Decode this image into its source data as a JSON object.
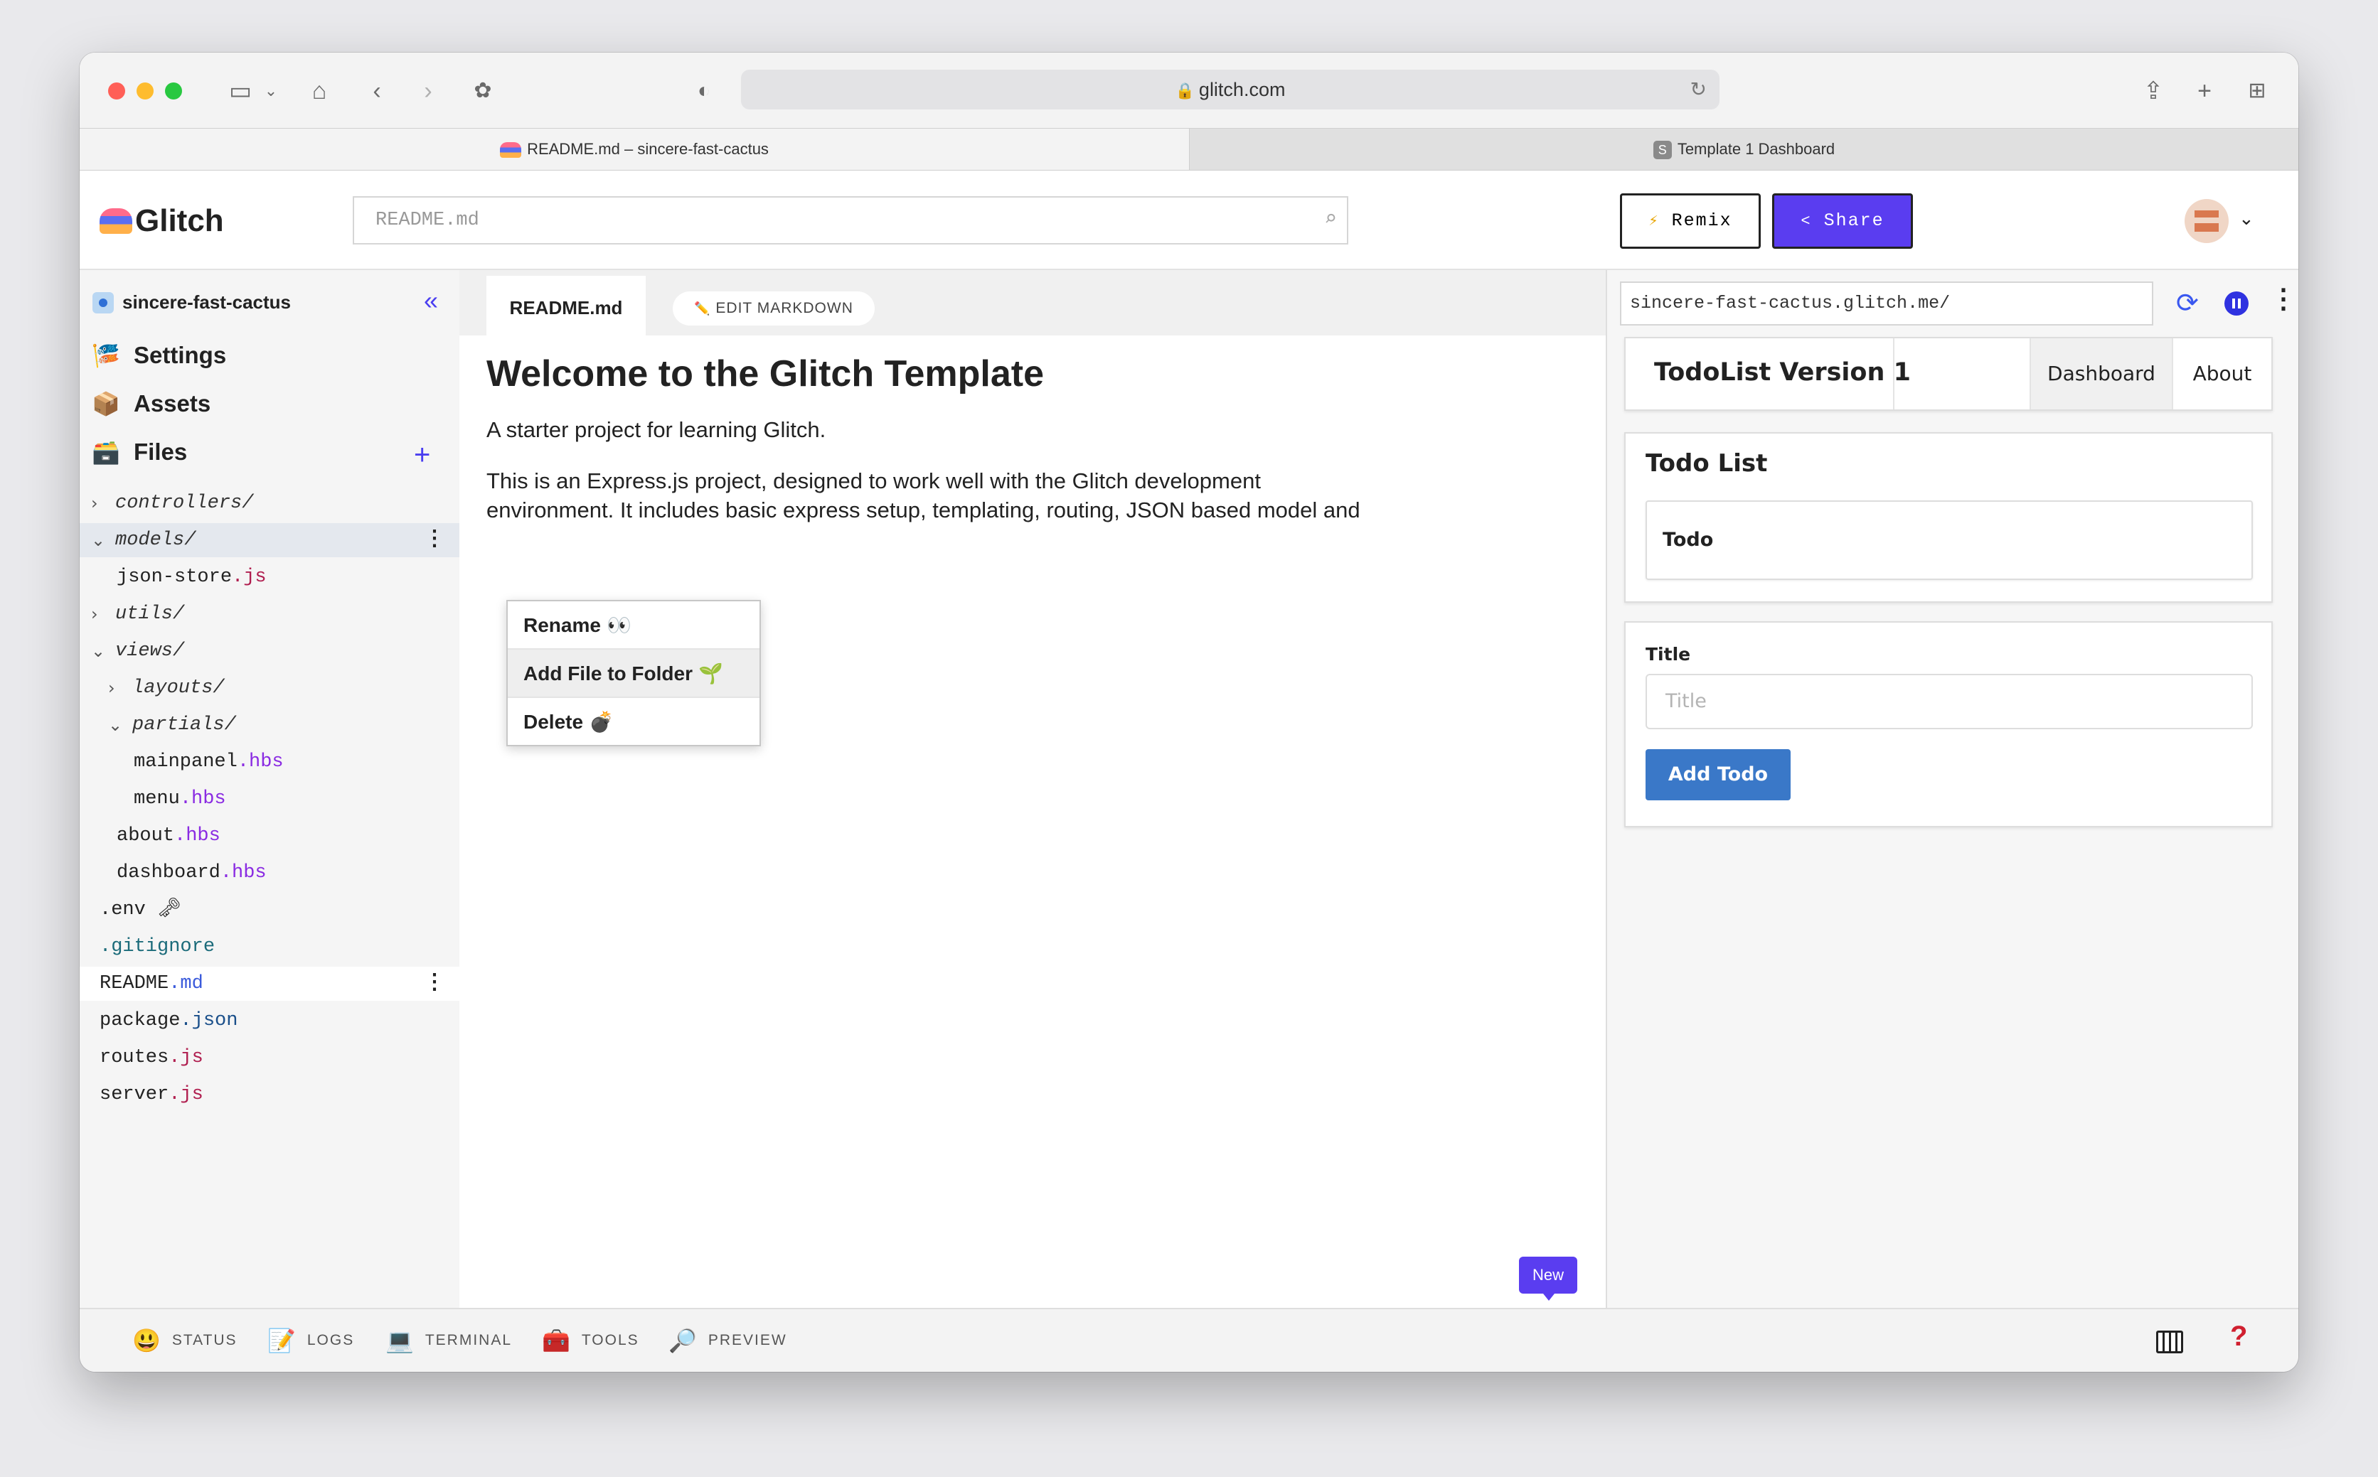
{
  "browser": {
    "url": "glitch.com",
    "tabs": [
      {
        "label": "README.md – sincere-fast-cactus",
        "active": true
      },
      {
        "label": "Template 1 Dashboard",
        "active": false,
        "favicon_letter": "S"
      }
    ]
  },
  "header": {
    "logo_text": "Glitch",
    "search_placeholder": "README.md",
    "remix_label": "Remix",
    "remix_icon": "⚡",
    "share_label": "Share",
    "share_icon": "<"
  },
  "sidebar": {
    "project_name": "sincere-fast-cactus",
    "nav": [
      {
        "label": "Settings",
        "icon": "🎏"
      },
      {
        "label": "Assets",
        "icon": "📦"
      },
      {
        "label": "Files",
        "icon": "🗃️"
      }
    ],
    "files": [
      {
        "name": "controllers/",
        "ext": ""
      },
      {
        "name": "models/",
        "ext": ""
      },
      {
        "name": "json-store",
        "ext": ".js"
      },
      {
        "name": "utils/",
        "ext": ""
      },
      {
        "name": "views/",
        "ext": ""
      },
      {
        "name": "layouts/",
        "ext": ""
      },
      {
        "name": "partials/",
        "ext": ""
      },
      {
        "name": "mainpanel",
        "ext": ".hbs"
      },
      {
        "name": "menu",
        "ext": ".hbs"
      },
      {
        "name": "about",
        "ext": ".hbs"
      },
      {
        "name": "dashboard",
        "ext": ".hbs"
      },
      {
        "name": ".env",
        "ext": "🗝"
      },
      {
        "name": ".gitignore",
        "ext": ""
      },
      {
        "name": "README",
        "ext": ".md"
      },
      {
        "name": "package",
        "ext": ".json"
      },
      {
        "name": "routes",
        "ext": ".js"
      },
      {
        "name": "server",
        "ext": ".js"
      }
    ]
  },
  "context_menu": {
    "items": [
      {
        "label": "Rename",
        "emoji": "👀"
      },
      {
        "label": "Add File to Folder",
        "emoji": "🌱"
      },
      {
        "label": "Delete",
        "emoji": "💣"
      }
    ]
  },
  "editor": {
    "tab_label": "README.md",
    "edit_markdown_label": "EDIT MARKDOWN",
    "edit_markdown_icon": "✏️",
    "heading": "Welcome to the Glitch Template",
    "paragraph1": "A starter project for learning Glitch.",
    "paragraph2": "This is an Express.js project, designed to work well with the Glitch development environment. It includes basic express setup, templating, routing, JSON based model and session support.",
    "new_badge": "New"
  },
  "preview": {
    "url": "sincere-fast-cactus.glitch.me/",
    "app_title": "TodoList Version 1",
    "nav_dashboard": "Dashboard",
    "nav_about": "About",
    "card_title": "Todo List",
    "todo_column": "Todo",
    "field_label": "Title",
    "field_placeholder": "Title",
    "add_button": "Add Todo"
  },
  "footer": {
    "items": [
      {
        "label": "STATUS",
        "icon": "😃"
      },
      {
        "label": "LOGS",
        "icon": "📝"
      },
      {
        "label": "TERMINAL",
        "icon": "💻"
      },
      {
        "label": "TOOLS",
        "icon": "🧰"
      },
      {
        "label": "PREVIEW",
        "icon": "🔎"
      }
    ],
    "help_label": "?"
  }
}
